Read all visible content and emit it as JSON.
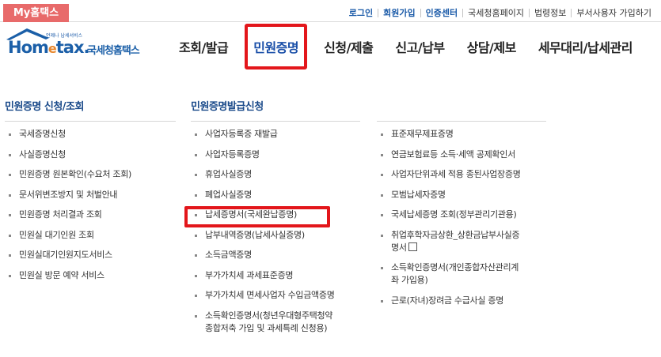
{
  "topbar": {
    "my_tab": "My홈택스",
    "links": [
      "로그인",
      "회원가입",
      "인증센터",
      "국세청홈페이지",
      "법령정보",
      "부서사용자 가입하기"
    ]
  },
  "logo": {
    "tagline": "언제나 납세서비스",
    "wordmark_pre": "Hom",
    "wordmark_e": "e",
    "wordmark_post": "tax.",
    "korean": "국세청홈택스"
  },
  "nav": {
    "items": [
      "조회/발급",
      "민원증명",
      "신청/제출",
      "신고/납부",
      "상담/제보",
      "세무대리/납세관리"
    ],
    "active_index": 1
  },
  "col1": {
    "heading": "민원증명 신청/조회",
    "items": [
      "국세증명신청",
      "사실증명신청",
      "민원증명 원본확인(수요처 조회)",
      "문서위변조방지 및 처벌안내",
      "민원증명 처리결과 조회",
      "민원실 대기인원 조회",
      "민원실대기인원지도서비스",
      "민원실 방문 예약 서비스"
    ]
  },
  "col2": {
    "heading": "민원증명발급신청",
    "items": [
      "사업자등록증 재발급",
      "사업자등록증명",
      "휴업사실증명",
      "폐업사실증명",
      "납세증명서(국세완납증명)",
      "납부내역증명(납세사실증명)",
      "소득금액증명",
      "부가가치세 과세표준증명",
      "부가가치세 면세사업자 수입금액증명",
      "소득확인증명서(청년우대형주택청약",
      "종합저축 가입 및 과세특례 신청용)"
    ]
  },
  "col3": {
    "items": [
      "표준재무제표증명",
      "연금보험료등 소득·세액 공제확인서",
      "사업자단위과세 적용 종된사업장증명",
      "모범납세자증명",
      "국세납세증명 조회(정부관리기관용)",
      "취업후학자금상환_상환금납부사실증",
      "명서",
      "소득확인증명서(개인종합자산관리계",
      "좌 가입용)",
      "근로(자녀)장려금 수급사실 증명"
    ]
  },
  "colors": {
    "accent_red": "#e3161b",
    "brand_blue": "#1b5fa8",
    "tab_pink": "#e86a6a"
  }
}
